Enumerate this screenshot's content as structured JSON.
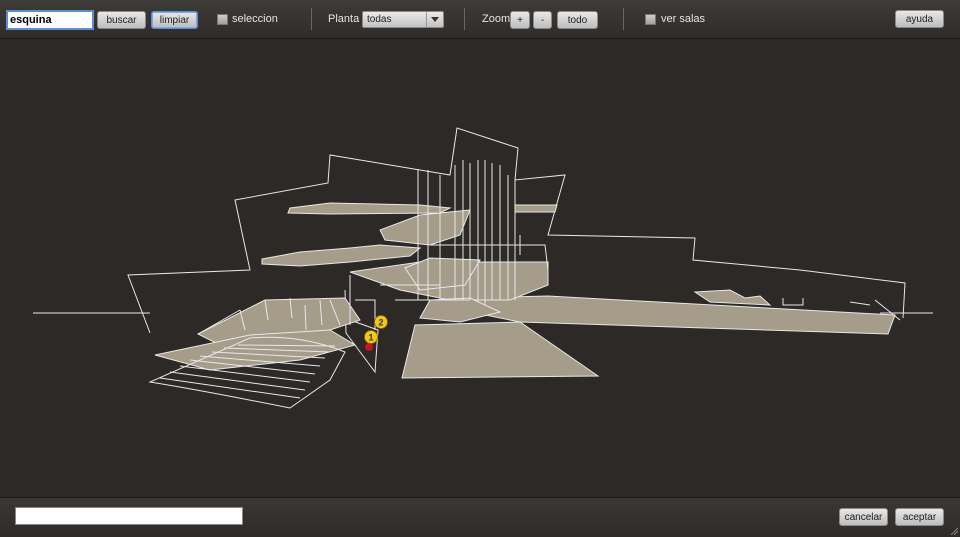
{
  "toolbar": {
    "search_value": "esquina",
    "search_label": "buscar",
    "clear_label": "limpiar",
    "selection_label": "seleccion",
    "floor_label": "Planta",
    "floor_selected": "todas",
    "zoom_label": "Zoom",
    "zoom_in": "+",
    "zoom_out": "-",
    "zoom_all": "todo",
    "show_rooms_label": "ver salas",
    "help_label": "ayuda"
  },
  "map": {
    "markers": [
      {
        "label": "1",
        "color": "#f3c81c"
      },
      {
        "label": "2",
        "color": "#f3c81c"
      }
    ],
    "floor_fill": "#a59c8a",
    "line_color": "#e8e8e8",
    "highlight_color": "#c4161c"
  },
  "footer": {
    "status_value": "",
    "cancel_label": "cancelar",
    "accept_label": "aceptar"
  }
}
